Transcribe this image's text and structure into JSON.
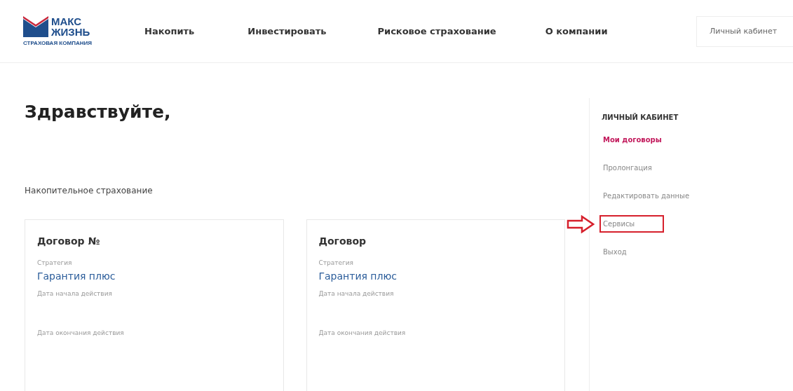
{
  "logo": {
    "line_1": "МАКС",
    "line_2": "ЖИЗНЬ",
    "tagline": "СТРАХОВАЯ КОМПАНИЯ"
  },
  "nav": [
    "Накопить",
    "Инвестировать",
    "Рисковое страхование",
    "О компании"
  ],
  "login_button": "Личный кабинет",
  "greeting": "Здравствуйте,",
  "section_title": "Накопительное страхование",
  "contracts": [
    {
      "title": "Договор №",
      "strategy_label": "Стратегия",
      "strategy": "Гарантия плюс",
      "start_label": "Дата начала действия",
      "end_label": "Дата окончания действия"
    },
    {
      "title": "Договор",
      "strategy_label": "Стратегия",
      "strategy": "Гарантия плюс",
      "start_label": "Дата начала действия",
      "end_label": "Дата окончания действия"
    }
  ],
  "sidebar": {
    "title": "ЛИЧНЫЙ КАБИНЕТ",
    "items": [
      {
        "label": "Мои договоры",
        "selected": true,
        "highlighted": false
      },
      {
        "label": "Пролонгация",
        "selected": false,
        "highlighted": false
      },
      {
        "label": "Редактировать данные",
        "selected": false,
        "highlighted": false
      },
      {
        "label": "Сервисы",
        "selected": false,
        "highlighted": true
      },
      {
        "label": "Выход",
        "selected": false,
        "highlighted": false
      }
    ]
  }
}
